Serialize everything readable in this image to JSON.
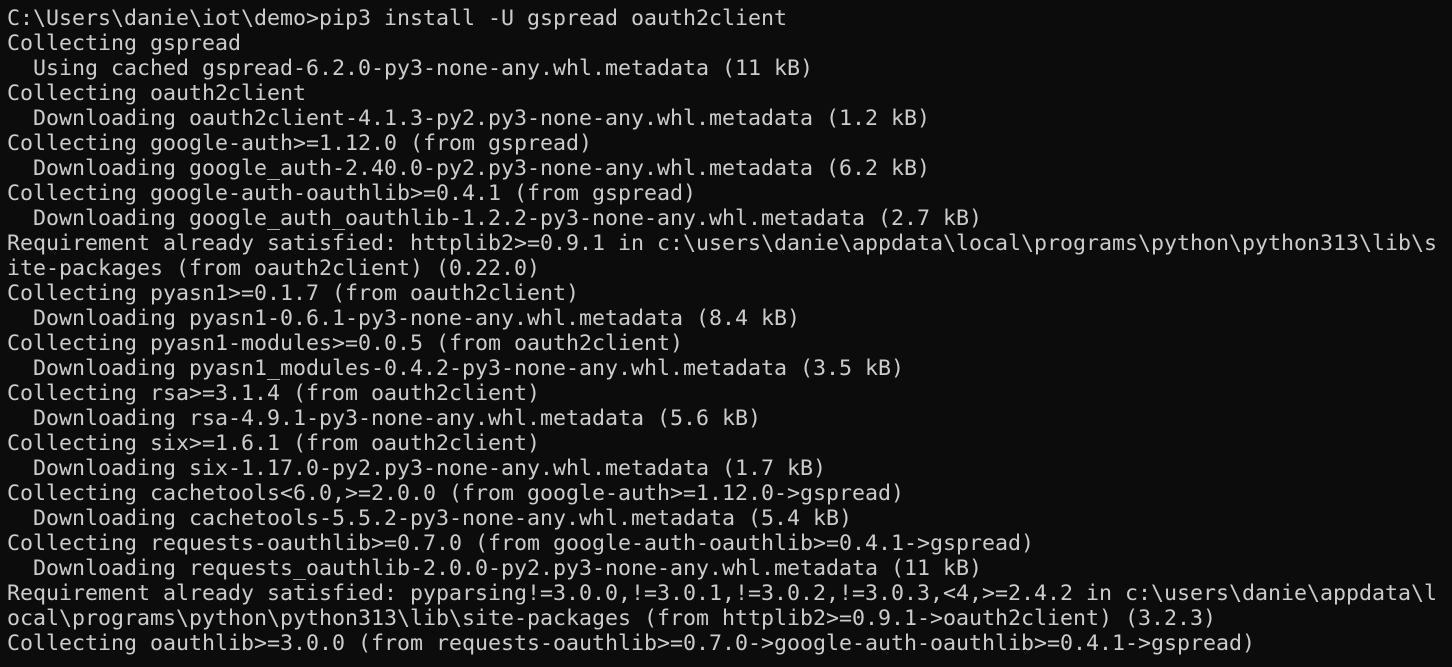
{
  "terminal": {
    "lines": [
      "C:\\Users\\danie\\iot\\demo>pip3 install -U gspread oauth2client",
      "Collecting gspread",
      "  Using cached gspread-6.2.0-py3-none-any.whl.metadata (11 kB)",
      "Collecting oauth2client",
      "  Downloading oauth2client-4.1.3-py2.py3-none-any.whl.metadata (1.2 kB)",
      "Collecting google-auth>=1.12.0 (from gspread)",
      "  Downloading google_auth-2.40.0-py2.py3-none-any.whl.metadata (6.2 kB)",
      "Collecting google-auth-oauthlib>=0.4.1 (from gspread)",
      "  Downloading google_auth_oauthlib-1.2.2-py3-none-any.whl.metadata (2.7 kB)",
      "Requirement already satisfied: httplib2>=0.9.1 in c:\\users\\danie\\appdata\\local\\programs\\python\\python313\\lib\\s",
      "ite-packages (from oauth2client) (0.22.0)",
      "Collecting pyasn1>=0.1.7 (from oauth2client)",
      "  Downloading pyasn1-0.6.1-py3-none-any.whl.metadata (8.4 kB)",
      "Collecting pyasn1-modules>=0.0.5 (from oauth2client)",
      "  Downloading pyasn1_modules-0.4.2-py3-none-any.whl.metadata (3.5 kB)",
      "Collecting rsa>=3.1.4 (from oauth2client)",
      "  Downloading rsa-4.9.1-py3-none-any.whl.metadata (5.6 kB)",
      "Collecting six>=1.6.1 (from oauth2client)",
      "  Downloading six-1.17.0-py2.py3-none-any.whl.metadata (1.7 kB)",
      "Collecting cachetools<6.0,>=2.0.0 (from google-auth>=1.12.0->gspread)",
      "  Downloading cachetools-5.5.2-py3-none-any.whl.metadata (5.4 kB)",
      "Collecting requests-oauthlib>=0.7.0 (from google-auth-oauthlib>=0.4.1->gspread)",
      "  Downloading requests_oauthlib-2.0.0-py2.py3-none-any.whl.metadata (11 kB)",
      "Requirement already satisfied: pyparsing!=3.0.0,!=3.0.1,!=3.0.2,!=3.0.3,<4,>=2.4.2 in c:\\users\\danie\\appdata\\l",
      "ocal\\programs\\python\\python313\\lib\\site-packages (from httplib2>=0.9.1->oauth2client) (3.2.3)",
      "Collecting oauthlib>=3.0.0 (from requests-oauthlib>=0.7.0->google-auth-oauthlib>=0.4.1->gspread)"
    ]
  },
  "colors": {
    "background": "#0c0c0c",
    "foreground": "#cccccc"
  }
}
